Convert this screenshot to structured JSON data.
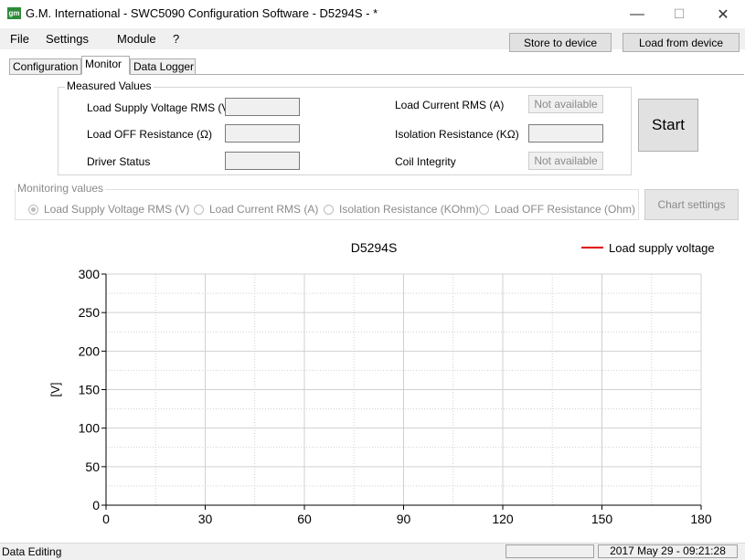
{
  "window": {
    "title": "G.M. International - SWC5090 Configuration Software - D5294S -  *",
    "app_icon_text": "gm",
    "minimize": "—",
    "maximize": "☐",
    "close": "✕"
  },
  "menu": {
    "items": [
      "File",
      "Settings",
      "Module",
      "?"
    ],
    "store_button": "Store to device",
    "load_button": "Load from device"
  },
  "tabs": [
    "Configuration",
    "Monitor",
    "Data Logger"
  ],
  "measured": {
    "legend": "Measured Values",
    "load_supply_voltage_label": "Load Supply Voltage RMS (V)",
    "load_off_resistance_label": "Load OFF Resistance (Ω)",
    "driver_status_label": "Driver Status",
    "load_current_label": "Load Current RMS (A)",
    "load_current_value": "Not available",
    "isolation_resistance_label": "Isolation Resistance (KΩ)",
    "coil_integrity_label": "Coil Integrity",
    "coil_integrity_value": "Not available"
  },
  "start_button": "Start",
  "monitoring": {
    "legend": "Monitoring values",
    "options": [
      "Load Supply Voltage RMS (V)",
      "Load Current RMS (A)",
      "Isolation Resistance (KOhm)",
      "Load OFF Resistance (Ohm)"
    ],
    "selected_index": 0,
    "chart_settings_button": "Chart settings"
  },
  "chart_data": {
    "type": "line",
    "title": "D5294S",
    "ylabel": "[V]",
    "xlabel": "",
    "xlim": [
      0,
      180
    ],
    "ylim": [
      0,
      300
    ],
    "xticks": [
      0,
      30,
      60,
      90,
      120,
      150,
      180
    ],
    "yticks": [
      0,
      50,
      100,
      150,
      200,
      250,
      300
    ],
    "grid": true,
    "legend_position": "top-right",
    "series": [
      {
        "name": "Load supply voltage",
        "color": "#e00000",
        "x": [],
        "y": []
      }
    ]
  },
  "status": {
    "left": "Data Editing",
    "datetime": "2017 May 29 - 09:21:28"
  }
}
